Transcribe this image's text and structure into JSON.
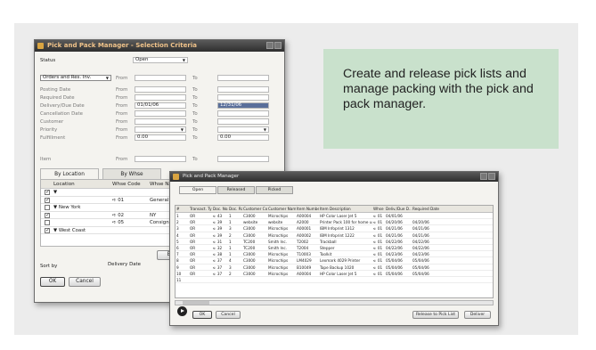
{
  "selection": {
    "title": "Pick and Pack Manager - Selection Criteria",
    "status_label": "Status",
    "status_value": "Open",
    "doc_type": "Orders and Res. Inv.",
    "from": "From",
    "to": "To",
    "fields": [
      {
        "label": "Posting Date",
        "from": "",
        "to": ""
      },
      {
        "label": "Required Date",
        "from": "",
        "to": ""
      },
      {
        "label": "Delivery/Due Date",
        "from": "01/01/06",
        "to": "12/31/06"
      },
      {
        "label": "Cancellation Date",
        "from": "",
        "to": ""
      },
      {
        "label": "Customer",
        "from": "",
        "to": ""
      },
      {
        "label": "Priority",
        "from": "",
        "to": ""
      },
      {
        "label": "Fulfillment",
        "from": "0.00",
        "to": "0.00"
      }
    ],
    "item_label": "Item",
    "tabs": [
      "By Location",
      "By Whse"
    ],
    "grid_headers": [
      "Location",
      "Whse Code",
      "Whse Na"
    ],
    "grid_rows": [
      {
        "checked": true,
        "location": "▼",
        "code": "",
        "name": ""
      },
      {
        "checked": true,
        "location": "",
        "code": "01",
        "name": "General W"
      },
      {
        "checked": false,
        "location": "▼ New York",
        "code": "",
        "name": ""
      },
      {
        "checked": true,
        "location": "",
        "code": "02",
        "name": "NY"
      },
      {
        "checked": false,
        "location": "",
        "code": "05",
        "name": "Consignm"
      },
      {
        "checked": true,
        "location": "▼ West Coast",
        "code": "",
        "name": ""
      }
    ],
    "expand_label": "Exper",
    "sort_by_label": "Sort by",
    "sort_by_value": "Delivery Date",
    "ok_label": "OK",
    "cancel_label": "Cancel"
  },
  "callout": {
    "text": "Create and release pick lists and manage packing with the pick and pack manager."
  },
  "pickpack": {
    "title": "Pick and Pack Manager",
    "tabs": [
      "Open",
      "Released",
      "Picked"
    ],
    "headers": [
      "#",
      "",
      "Transact. Type",
      "Doc. No.",
      "Doc. Row",
      "Customer Code",
      "Customer Name",
      "Item Number",
      "Item Description",
      "Whse",
      "Deliv./Due D...",
      "Required Date"
    ],
    "rows": [
      [
        "1",
        "",
        "OR",
        "43",
        "1",
        "C3000",
        "Microchips",
        "A00004",
        "HP Color Laser Jet 5",
        "01",
        "04/01/06",
        ""
      ],
      [
        "2",
        "",
        "OR",
        "39",
        "1",
        "website",
        "website",
        "A2000",
        "Printer Pack 100 for home use",
        "01",
        "04/20/06",
        "04/20/06"
      ],
      [
        "3",
        "",
        "OR",
        "39",
        "3",
        "C3000",
        "Microchips",
        "A00001",
        "IBM Infoprint 1312",
        "01",
        "04/21/06",
        "04/21/06"
      ],
      [
        "4",
        "",
        "OR",
        "39",
        "2",
        "C3000",
        "Microchips",
        "A00002",
        "IBM Infoprint 1222",
        "01",
        "04/21/06",
        "04/21/06"
      ],
      [
        "5",
        "",
        "OR",
        "31",
        "1",
        "TC200",
        "Smith Inc.",
        "T2002",
        "Trackball",
        "01",
        "04/22/06",
        "04/22/06"
      ],
      [
        "6",
        "",
        "OR",
        "32",
        "1",
        "TC200",
        "Smith Inc.",
        "T2004",
        "Stepper",
        "01",
        "04/22/06",
        "04/22/06"
      ],
      [
        "7",
        "",
        "OR",
        "38",
        "1",
        "C3000",
        "Microchips",
        "T10003",
        "Toolkit",
        "01",
        "04/23/06",
        "04/23/06"
      ],
      [
        "8",
        "",
        "OR",
        "37",
        "4",
        "C3000",
        "Microchips",
        "LM4029",
        "Lexmark 4029 Printer",
        "01",
        "05/04/06",
        "05/04/06"
      ],
      [
        "9",
        "",
        "OR",
        "37",
        "3",
        "C3000",
        "Microchips",
        "B10049",
        "Tape Backup 1020",
        "01",
        "05/04/06",
        "05/04/06"
      ],
      [
        "10",
        "",
        "OR",
        "37",
        "2",
        "C3000",
        "Microchips",
        "A00004",
        "HP Color Laser Jet 5",
        "01",
        "05/04/06",
        "05/04/06"
      ],
      [
        "11",
        "",
        "",
        "",
        "",
        "",
        "",
        "",
        "",
        "",
        "",
        ""
      ]
    ],
    "ok_label": "OK",
    "cancel_label": "Cancel",
    "release_label": "Release to Pick List",
    "deliver_label": "Deliver"
  }
}
